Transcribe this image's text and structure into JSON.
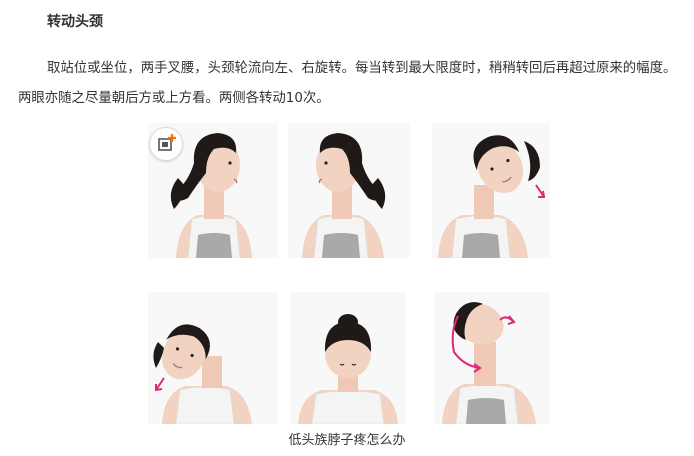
{
  "article": {
    "heading": "转动头颈",
    "paragraph": "取站位或坐位，两手叉腰，头颈轮流向左、右旋转。每当转到最大限度时，稍稍转回后再超过原来的幅度。两眼亦随之尽量朝后方或上方看。两侧各转动10次。",
    "caption": "低头族脖子疼怎么办"
  },
  "image_tool": {
    "icon": "add-image-icon",
    "accent_color": "#ff6a00"
  },
  "photos": {
    "top_row": [
      {
        "name": "woman-turning-head-right",
        "pose": "profile-right"
      },
      {
        "name": "woman-turning-head-left",
        "pose": "profile-left"
      },
      {
        "name": "woman-tilting-head-right",
        "pose": "tilt-right",
        "arrow": "down-right"
      }
    ],
    "bottom_row": [
      {
        "name": "woman-tilting-head-left",
        "pose": "tilt-left",
        "arrow": "down-left"
      },
      {
        "name": "woman-bowing-head-down",
        "pose": "bow-down"
      },
      {
        "name": "woman-rotating-head-up",
        "pose": "look-up",
        "arrow": "circular"
      }
    ]
  },
  "colors": {
    "text": "#333333",
    "arrow": "#e0287a",
    "hair": "#1f1a17",
    "skin": "#f2d3c2",
    "top": "#f4f4f4",
    "bra": "#a9a9a9"
  }
}
